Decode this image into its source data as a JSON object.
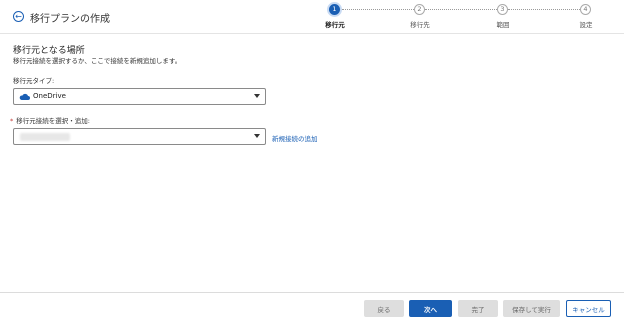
{
  "header": {
    "title": "移行プランの作成"
  },
  "stepper": {
    "steps": [
      {
        "number": "1",
        "label": "移行元",
        "state": "active"
      },
      {
        "number": "2",
        "label": "移行先",
        "state": "inactive"
      },
      {
        "number": "3",
        "label": "範囲",
        "state": "inactive"
      },
      {
        "number": "4",
        "label": "設定",
        "state": "inactive"
      }
    ]
  },
  "main": {
    "section_title": "移行元となる場所",
    "section_desc": "移行元接続を選択するか、ここで接続を新規追加します。",
    "source_type": {
      "label": "移行元タイプ:",
      "value": "OneDrive",
      "icon": "onedrive-cloud-icon"
    },
    "connection": {
      "required_mark": "*",
      "label": "移行元接続を選択・追加:",
      "value": ""
    },
    "add_link": "新規接続の追加"
  },
  "footer": {
    "back": "戻る",
    "next": "次へ",
    "finish": "完了",
    "save_run": "保存して実行",
    "cancel": "キャンセル"
  },
  "colors": {
    "accent": "#1a5fb4",
    "required": "#c23934",
    "disabled_bg": "#dedede"
  }
}
